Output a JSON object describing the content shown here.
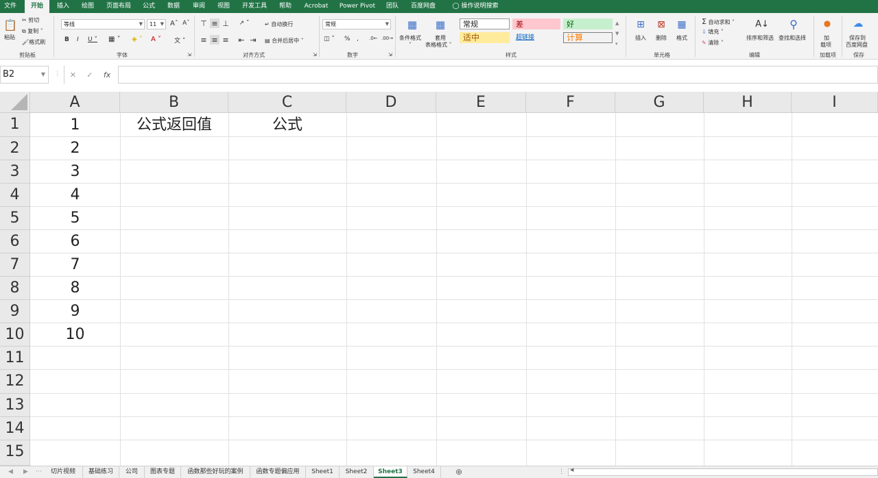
{
  "menu": {
    "tabs": [
      "文件",
      "开始",
      "插入",
      "绘图",
      "页面布局",
      "公式",
      "数据",
      "审阅",
      "视图",
      "开发工具",
      "帮助",
      "Acrobat",
      "Power Pivot",
      "团队",
      "百度网盘"
    ],
    "active": "开始",
    "search": "操作说明搜索"
  },
  "ribbon": {
    "clipboard": {
      "paste": "粘贴",
      "cut": "剪切",
      "copy": "复制",
      "format_painter": "格式刷",
      "group": "剪贴板"
    },
    "font": {
      "name": "等线",
      "size": "11",
      "group": "字体"
    },
    "alignment": {
      "wrap": "自动换行",
      "merge": "合并后居中",
      "group": "对齐方式"
    },
    "number": {
      "format": "常规",
      "group": "数字"
    },
    "styles": {
      "conditional": "条件格式",
      "table": "套用",
      "table2": "表格格式",
      "group": "样式",
      "cells": [
        "常规",
        "差",
        "好",
        "适中",
        "超链接",
        "计算"
      ]
    },
    "cells": {
      "insert": "插入",
      "delete": "删除",
      "format": "格式",
      "group": "单元格"
    },
    "editing": {
      "autosum": "自动求和",
      "fill": "填充",
      "clear": "清除",
      "sort": "排序和筛选",
      "find": "查找和选择",
      "group": "编辑"
    },
    "addins": {
      "label1": "加",
      "label2": "载项",
      "group": "加载项"
    },
    "save": {
      "label1": "保存到",
      "label2": "百度网盘",
      "group": "保存"
    }
  },
  "formula_bar": {
    "name_box": "B2",
    "content": ""
  },
  "sheet": {
    "columns": [
      "A",
      "B",
      "C",
      "D",
      "E",
      "F",
      "G",
      "H",
      "I"
    ],
    "rows": [
      "1",
      "2",
      "3",
      "4",
      "5",
      "6",
      "7",
      "8",
      "9",
      "10",
      "11",
      "12",
      "13",
      "14",
      "15"
    ],
    "cells": {
      "A": [
        "1",
        "2",
        "3",
        "4",
        "5",
        "6",
        "7",
        "8",
        "9",
        "10"
      ],
      "B1": "公式返回值",
      "C1": "公式"
    },
    "selected": "B2"
  },
  "sheet_tabs": [
    "切片视频",
    "基础练习",
    "公司",
    "图表专题",
    "函数那些好玩的案例",
    "函数专题偏应用",
    "Sheet1",
    "Sheet2",
    "Sheet3",
    "Sheet4"
  ],
  "active_sheet": "Sheet3"
}
